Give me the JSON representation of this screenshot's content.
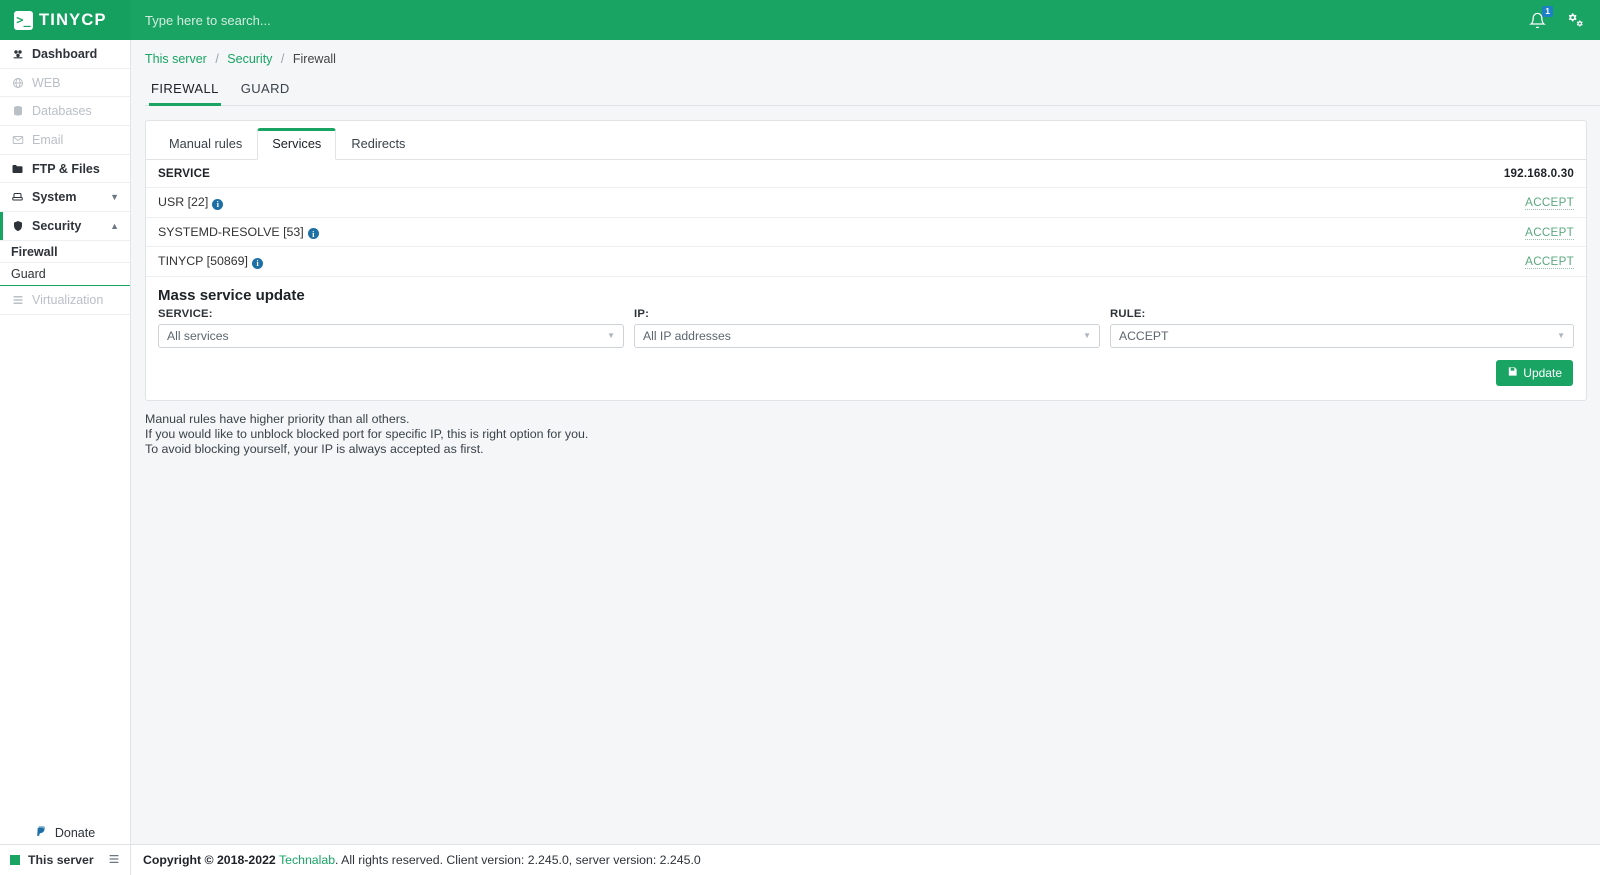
{
  "topbar": {
    "brand_name": "TINYCP",
    "brand_mark": "terminal-prompt-icon",
    "search_placeholder": "Type here to search...",
    "search_value": "",
    "notification_count": "1",
    "notification_icon": "bell-icon",
    "settings_icon": "gears-icon"
  },
  "sidebar": {
    "items": [
      {
        "label": "Dashboard",
        "icon": "dashboard-icon",
        "state": "normal"
      },
      {
        "label": "WEB",
        "icon": "globe-icon",
        "state": "disabled"
      },
      {
        "label": "Databases",
        "icon": "database-icon",
        "state": "disabled"
      },
      {
        "label": "Email",
        "icon": "envelope-icon",
        "state": "disabled"
      },
      {
        "label": "FTP & Files",
        "icon": "folder-icon",
        "state": "normal"
      },
      {
        "label": "System",
        "icon": "system-icon",
        "state": "normal",
        "caret": "chevron-down-icon"
      },
      {
        "label": "Security",
        "icon": "shield-icon",
        "state": "active",
        "caret": "chevron-up-icon"
      }
    ],
    "security_children": [
      {
        "label": "Firewall",
        "selected": true
      },
      {
        "label": "Guard",
        "selected": false
      }
    ],
    "after_items": [
      {
        "label": "Virtualization",
        "icon": "virtualization-icon",
        "state": "disabled"
      }
    ],
    "donate": {
      "label": "Donate",
      "icon": "paypal-icon"
    }
  },
  "breadcrumb": {
    "items": [
      "This server",
      "Security",
      "Firewall"
    ],
    "separator": "/"
  },
  "page_tabs": [
    {
      "label": "FIREWALL",
      "selected": true
    },
    {
      "label": "GUARD",
      "selected": false
    }
  ],
  "sub_tabs": [
    {
      "label": "Manual rules",
      "selected": false
    },
    {
      "label": "Services",
      "selected": true
    },
    {
      "label": "Redirects",
      "selected": false
    }
  ],
  "services_table": {
    "columns": [
      "SERVICE",
      "192.168.0.30"
    ],
    "rows": [
      {
        "service": "USR [22]",
        "info_icon": "info-icon",
        "rule": "ACCEPT"
      },
      {
        "service": "SYSTEMD-RESOLVE [53]",
        "info_icon": "info-icon",
        "rule": "ACCEPT"
      },
      {
        "service": "TINYCP [50869]",
        "info_icon": "info-icon",
        "rule": "ACCEPT"
      }
    ]
  },
  "mass_update": {
    "title": "Mass service update",
    "service_label": "SERVICE:",
    "service_value": "All services",
    "ip_label": "IP:",
    "ip_value": "All IP addresses",
    "rule_label": "RULE:",
    "rule_value": "ACCEPT",
    "update_button": "Update",
    "update_icon": "save-icon"
  },
  "notes": [
    "Manual rules have higher priority than all others.",
    "If you would like to unblock blocked port for specific IP, this is right option for you.",
    "To avoid blocking yourself, your IP is always accepted as first."
  ],
  "bottombar": {
    "server_label": "This server",
    "server_icon": "list-icon",
    "copyright_bold": "Copyright © 2018-2022",
    "company": "Technalab",
    "copyright_rest": ". All rights reserved. Client version: 2.245.0, server version: 2.245.0"
  },
  "colors": {
    "brand_green": "#19a463",
    "badge_blue": "#1d7fc4",
    "info_blue": "#1d6fa5",
    "accept_green": "#5aa87e"
  }
}
